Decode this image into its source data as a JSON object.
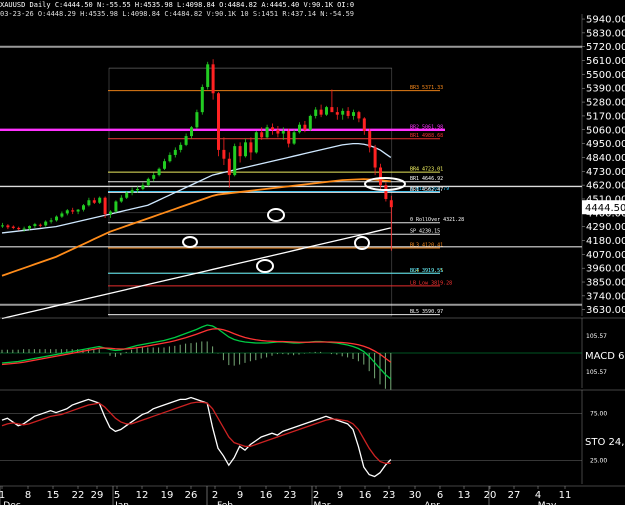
{
  "header": {
    "symbol": "XAUUSD",
    "period": "Daily",
    "stats": "C:4444.50 N:-55.55 H:4535.98 L:4098.84 O:4484.82 A:4445.40 V:90.1K OI:0",
    "date_line": "03-23-26 O:4448.29 H:4535.98 L:4098.84 C:4484.82 V:90.1K 10 S:1451 R:437.14 N:-54.59"
  },
  "chart_data": [
    {
      "type": "candlestick",
      "panel": "price",
      "title": "XAUUSD Daily",
      "ylim": [
        3580,
        5980
      ],
      "ytick_labels": [
        "5940.00",
        "5830.00",
        "5720.00",
        "5610.00",
        "5500.00",
        "5390.00",
        "5280.00",
        "5170.00",
        "5060.00",
        "4950.00",
        "4840.00",
        "4730.00",
        "4620.00",
        "4510.00",
        "4400.00",
        "4290.00",
        "4180.00",
        "4070.00",
        "3960.00",
        "3850.00",
        "3740.00",
        "3630.00"
      ],
      "last_price": "4444.50",
      "candles": [
        [
          4300,
          4320,
          4280,
          4300
        ],
        [
          4300,
          4310,
          4270,
          4285
        ],
        [
          4290,
          4300,
          4270,
          4280
        ],
        [
          4280,
          4290,
          4260,
          4270
        ],
        [
          4270,
          4290,
          4250,
          4275
        ],
        [
          4275,
          4300,
          4260,
          4295
        ],
        [
          4295,
          4320,
          4280,
          4310
        ],
        [
          4305,
          4315,
          4285,
          4300
        ],
        [
          4300,
          4340,
          4290,
          4330
        ],
        [
          4330,
          4360,
          4315,
          4340
        ],
        [
          4340,
          4380,
          4330,
          4370
        ],
        [
          4370,
          4410,
          4360,
          4395
        ],
        [
          4395,
          4430,
          4380,
          4420
        ],
        [
          4420,
          4440,
          4390,
          4410
        ],
        [
          4410,
          4430,
          4390,
          4425
        ],
        [
          4425,
          4470,
          4410,
          4460
        ],
        [
          4460,
          4520,
          4450,
          4500
        ],
        [
          4500,
          4520,
          4470,
          4480
        ],
        [
          4480,
          4530,
          4470,
          4520
        ],
        [
          4520,
          4530,
          4360,
          4390
        ],
        [
          4390,
          4420,
          4360,
          4410
        ],
        [
          4410,
          4500,
          4400,
          4490
        ],
        [
          4490,
          4540,
          4480,
          4520
        ],
        [
          4520,
          4570,
          4510,
          4560
        ],
        [
          4560,
          4600,
          4540,
          4580
        ],
        [
          4580,
          4610,
          4560,
          4590
        ],
        [
          4590,
          4640,
          4580,
          4620
        ],
        [
          4620,
          4680,
          4610,
          4670
        ],
        [
          4670,
          4720,
          4650,
          4700
        ],
        [
          4700,
          4760,
          4690,
          4750
        ],
        [
          4750,
          4830,
          4740,
          4810
        ],
        [
          4810,
          4880,
          4800,
          4860
        ],
        [
          4860,
          4920,
          4840,
          4900
        ],
        [
          4900,
          4960,
          4880,
          4940
        ],
        [
          4940,
          5030,
          4930,
          5010
        ],
        [
          5010,
          5090,
          4990,
          5080
        ],
        [
          5080,
          5220,
          5070,
          5200
        ],
        [
          5200,
          5420,
          5180,
          5400
        ],
        [
          5400,
          5600,
          5380,
          5580
        ],
        [
          5580,
          5620,
          5300,
          5350
        ],
        [
          5350,
          5360,
          4850,
          4900
        ],
        [
          4900,
          5000,
          4780,
          4830
        ],
        [
          4830,
          4880,
          4600,
          4700
        ],
        [
          4700,
          4950,
          4690,
          4930
        ],
        [
          4930,
          4960,
          4800,
          4850
        ],
        [
          4850,
          4990,
          4840,
          4960
        ],
        [
          4960,
          5000,
          4820,
          4880
        ],
        [
          4880,
          5050,
          4870,
          5040
        ],
        [
          5040,
          5080,
          4980,
          5000
        ],
        [
          5000,
          5100,
          4990,
          5080
        ],
        [
          5080,
          5110,
          5020,
          5060
        ],
        [
          5060,
          5090,
          5000,
          5030
        ],
        [
          5030,
          5080,
          4980,
          5050
        ],
        [
          5050,
          5070,
          4920,
          4950
        ],
        [
          4950,
          5060,
          4940,
          5040
        ],
        [
          5040,
          5120,
          5030,
          5100
        ],
        [
          5100,
          5130,
          5040,
          5060
        ],
        [
          5060,
          5180,
          5050,
          5170
        ],
        [
          5170,
          5240,
          5150,
          5220
        ],
        [
          5220,
          5260,
          5160,
          5180
        ],
        [
          5180,
          5250,
          5170,
          5240
        ],
        [
          5240,
          5380,
          5220,
          5200
        ],
        [
          5200,
          5240,
          5140,
          5180
        ],
        [
          5180,
          5230,
          5140,
          5210
        ],
        [
          5210,
          5240,
          5150,
          5170
        ],
        [
          5170,
          5220,
          5140,
          5200
        ],
        [
          5200,
          5210,
          5120,
          5150
        ],
        [
          5150,
          5160,
          5020,
          5050
        ],
        [
          5050,
          5070,
          4880,
          4920
        ],
        [
          4920,
          4940,
          4700,
          4760
        ],
        [
          4760,
          4790,
          4580,
          4620
        ],
        [
          4620,
          4640,
          4490,
          4510
        ],
        [
          4500,
          4536,
          4099,
          4445
        ]
      ],
      "ma_series": [
        {
          "color": "#ff8c1a",
          "values": [
            3900,
            3915,
            3930,
            3945,
            3960,
            3975,
            3990,
            4005,
            4020,
            4035,
            4050,
            4070,
            4090,
            4110,
            4130,
            4150,
            4170,
            4190,
            4210,
            4230,
            4250,
            4265,
            4280,
            4295,
            4310,
            4325,
            4340,
            4355,
            4370,
            4385,
            4400,
            4415,
            4430,
            4445,
            4460,
            4475,
            4490,
            4505,
            4520,
            4535,
            4545,
            4550,
            4555,
            4560,
            4565,
            4570,
            4575,
            4580,
            4585,
            4590,
            4595,
            4600,
            4605,
            4610,
            4615,
            4620,
            4625,
            4630,
            4635,
            4640,
            4645,
            4650,
            4655,
            4660,
            4662,
            4664,
            4666,
            4668,
            4666,
            4664,
            4660,
            4655,
            4650
          ]
        },
        {
          "color": "#ffffff",
          "values": [
            3560,
            3570,
            3580,
            3590,
            3600,
            3610,
            3620,
            3630,
            3640,
            3650,
            3660,
            3670,
            3680,
            3690,
            3700,
            3710,
            3720,
            3730,
            3740,
            3750,
            3760,
            3770,
            3780,
            3790,
            3800,
            3810,
            3820,
            3830,
            3840,
            3850,
            3860,
            3870,
            3880,
            3890,
            3900,
            3910,
            3920,
            3930,
            3940,
            3950,
            3960,
            3970,
            3980,
            3990,
            4000,
            4010,
            4020,
            4030,
            4040,
            4050,
            4060,
            4070,
            4080,
            4090,
            4100,
            4110,
            4120,
            4130,
            4140,
            4150,
            4160,
            4170,
            4180,
            4190,
            4200,
            4210,
            4220,
            4230,
            4240,
            4250,
            4260,
            4270,
            4280
          ]
        },
        {
          "color": "#cfe8ff",
          "values": [
            4240,
            4245,
            4250,
            4255,
            4260,
            4265,
            4270,
            4275,
            4280,
            4285,
            4290,
            4300,
            4310,
            4320,
            4330,
            4340,
            4350,
            4360,
            4370,
            4380,
            4390,
            4400,
            4410,
            4420,
            4430,
            4440,
            4450,
            4460,
            4480,
            4500,
            4520,
            4540,
            4560,
            4580,
            4600,
            4620,
            4640,
            4660,
            4680,
            4700,
            4710,
            4720,
            4730,
            4740,
            4750,
            4760,
            4770,
            4780,
            4790,
            4800,
            4810,
            4820,
            4830,
            4840,
            4850,
            4860,
            4870,
            4880,
            4890,
            4900,
            4910,
            4920,
            4930,
            4940,
            4945,
            4950,
            4950,
            4945,
            4935,
            4920,
            4900,
            4870,
            4840
          ]
        }
      ],
      "levels": [
        {
          "price": 5720,
          "label": "",
          "color": "#ffffff"
        },
        {
          "price": 5371.33,
          "label": "BR3 5371.33",
          "color": "#ff8c1a"
        },
        {
          "price": 5060,
          "label": "BR2 5061.98",
          "color": "#ff33ff"
        },
        {
          "price": 4988.68,
          "label": "BR1 4988.68",
          "color": "#ff3333"
        },
        {
          "price": 4723.01,
          "label": "BR4 4723.01",
          "color": "#ffff66"
        },
        {
          "price": 4646.92,
          "label": "BR1 4646.92",
          "color": "#ffffff"
        },
        {
          "price": 4569.79,
          "label": "5 Min 4569.79",
          "color": "#33ccff"
        },
        {
          "price": 4562.47,
          "label": "BR1 4562.47",
          "color": "#ffffff"
        },
        {
          "price": 4321.28,
          "label": "0 RollOver 4321.28",
          "color": "#ffffff"
        },
        {
          "price": 4230.15,
          "label": "SP 4230.15",
          "color": "#ffffff"
        },
        {
          "price": 4120.41,
          "label": "BL3 4120.41",
          "color": "#ff8c1a"
        },
        {
          "price": 3919.55,
          "label": "BL4 3919.55",
          "color": "#ffff66"
        },
        {
          "price": 3919.51,
          "label": "BOT 3919.51",
          "color": "#33ccff"
        },
        {
          "price": 3819.28,
          "label": "LB Low 3819.28",
          "color": "#ff3333"
        },
        {
          "price": 3669,
          "label": "",
          "color": "#ffffff"
        },
        {
          "price": 3590.97,
          "label": "BL5 3590.97",
          "color": "#ffffff"
        }
      ]
    },
    {
      "type": "line",
      "panel": "macd",
      "title": "MACD 6,",
      "ylim": [
        -140,
        140
      ],
      "ytick_labels": [
        "105.57",
        "105.57"
      ],
      "series": [
        {
          "name": "",
          "color": "#00cc44",
          "values": [
            -40,
            -38,
            -36,
            -34,
            -30,
            -26,
            -22,
            -18,
            -14,
            -10,
            -6,
            -2,
            2,
            6,
            10,
            14,
            18,
            22,
            26,
            20,
            14,
            10,
            12,
            18,
            24,
            30,
            34,
            38,
            42,
            46,
            50,
            56,
            62,
            70,
            78,
            86,
            94,
            104,
            112,
            108,
            96,
            80,
            64,
            54,
            48,
            44,
            42,
            40,
            40,
            40,
            42,
            44,
            44,
            42,
            40,
            40,
            42,
            44,
            46,
            46,
            44,
            42,
            40,
            36,
            32,
            26,
            18,
            6,
            -14,
            -38,
            -62,
            -86,
            -104
          ]
        },
        {
          "name": "",
          "color": "#ff3333",
          "values": [
            -46,
            -44,
            -42,
            -40,
            -37,
            -33,
            -29,
            -25,
            -21,
            -17,
            -13,
            -9,
            -5,
            -1,
            3,
            7,
            11,
            15,
            19,
            20,
            19,
            17,
            16,
            16,
            18,
            21,
            24,
            28,
            32,
            36,
            40,
            44,
            49,
            55,
            61,
            68,
            75,
            83,
            91,
            96,
            97,
            93,
            86,
            77,
            69,
            62,
            57,
            53,
            50,
            48,
            47,
            46,
            46,
            45,
            44,
            43,
            43,
            43,
            44,
            44,
            44,
            44,
            43,
            42,
            40,
            37,
            33,
            27,
            19,
            8,
            -5,
            -21,
            -37
          ]
        }
      ]
    },
    {
      "type": "line",
      "panel": "stochastic",
      "title": "STO 24,",
      "ylim": [
        0,
        100
      ],
      "ytick_labels": [
        "75.00",
        "25.00"
      ],
      "series": [
        {
          "name": "",
          "color": "#ffffff",
          "values": [
            68,
            70,
            66,
            62,
            64,
            68,
            72,
            74,
            76,
            78,
            76,
            78,
            80,
            84,
            86,
            88,
            90,
            88,
            86,
            72,
            60,
            56,
            58,
            62,
            66,
            70,
            74,
            76,
            80,
            82,
            84,
            86,
            88,
            90,
            90,
            92,
            90,
            88,
            86,
            60,
            38,
            30,
            20,
            28,
            40,
            36,
            42,
            46,
            50,
            52,
            54,
            52,
            56,
            58,
            60,
            62,
            64,
            66,
            68,
            70,
            72,
            70,
            68,
            66,
            64,
            58,
            40,
            18,
            10,
            8,
            12,
            20,
            26
          ]
        },
        {
          "name": "",
          "color": "#cc2222",
          "values": [
            62,
            64,
            65,
            64,
            63,
            64,
            66,
            68,
            70,
            72,
            73,
            74,
            76,
            78,
            80,
            82,
            84,
            85,
            86,
            82,
            76,
            70,
            66,
            64,
            64,
            66,
            68,
            70,
            72,
            74,
            76,
            78,
            80,
            82,
            84,
            86,
            87,
            87,
            86,
            80,
            70,
            60,
            50,
            44,
            42,
            40,
            40,
            42,
            44,
            46,
            48,
            50,
            52,
            54,
            56,
            58,
            60,
            62,
            64,
            66,
            68,
            69,
            69,
            68,
            67,
            64,
            58,
            48,
            38,
            30,
            24,
            22,
            22
          ]
        }
      ]
    },
    {
      "type": "table",
      "panel": "time-axis",
      "x_tick_labels": [
        "1",
        "8",
        "15",
        "22",
        "29",
        "5",
        "12",
        "19",
        "26",
        "2",
        "9",
        "16",
        "23",
        "2",
        "9",
        "16",
        "23",
        "30",
        "6",
        "13",
        "20",
        "27",
        "4",
        "11"
      ],
      "month_labels": [
        "Dec",
        "Jan",
        "Feb",
        "Mar",
        "Apr",
        "May"
      ]
    }
  ]
}
